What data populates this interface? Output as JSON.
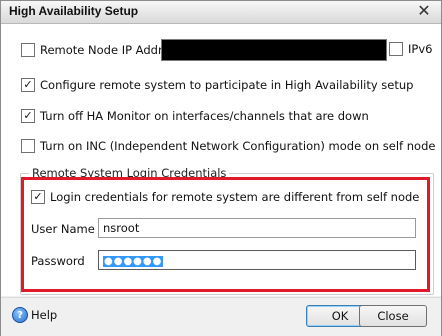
{
  "window": {
    "title": "High Availability Setup",
    "close_glyph": "✕"
  },
  "remote": {
    "ip_label": "Remote Node IP Address",
    "ipv6_label": "IPv6",
    "ipv6_checked": false
  },
  "options": [
    {
      "label": "Configure remote system to participate in High Availability setup",
      "checked": true
    },
    {
      "label": "Turn off HA Monitor on interfaces/channels that are down",
      "checked": true
    },
    {
      "label": "Turn on INC (Independent Network Configuration) mode on self node",
      "checked": false
    }
  ],
  "credentials": {
    "group_title": "Remote System Login Credentials",
    "different_label": "Login credentials for remote system are different from self node",
    "different_checked": true,
    "username_label": "User Name",
    "username_value": "nsroot",
    "password_label": "Password",
    "password_value": "●●●●●●"
  },
  "footer": {
    "help_label": "Help",
    "ok_label": "OK",
    "close_label": "Close"
  },
  "colors": {
    "highlight_box": "#e01a2b",
    "selection": "#3399ff"
  }
}
